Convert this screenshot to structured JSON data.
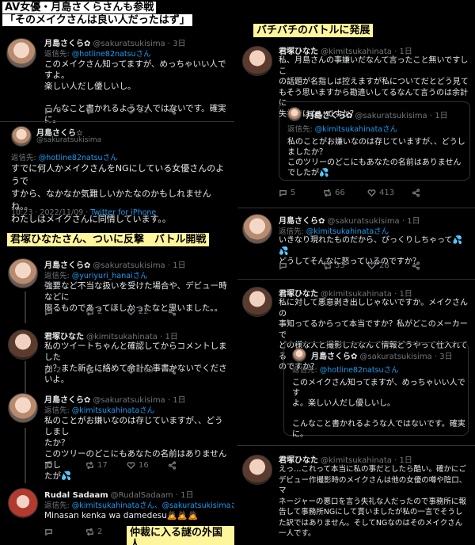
{
  "captions": {
    "top_left_1": "AV女優・月島さくらさんも参戦",
    "top_left_2": "「そのメイクさんは良い人だったはず」",
    "top_right": "バチバチのバトルに発展",
    "mid_left": "君塚ひなたさん、ついに反撃　バトル開戦",
    "bottom": "仲裁に入る謎の外国人"
  },
  "left": {
    "t1": {
      "name": "月島さくら✿",
      "handle": "@sakuratsukisima · 3日",
      "reply_prefix": "返信先: ",
      "reply_to": "@hotline82natsuさん",
      "body": "このメイクさん知ってますが、めっちゃいい人ですよ。\n楽しい人だし優しいし。\n\nこんなこと書かれるような人ではないです。確実に。",
      "replies": "8",
      "retweets": "",
      "likes": "21"
    },
    "t2": {
      "name": "月島さくら☆",
      "handle": "@sakuratsukisima",
      "reply_prefix": "返信先: ",
      "reply_to": "@hotline82natsuさん",
      "body": "すでに何人かメイクさんをNGにしている女優さんのようで\nすから、なかなか気難しいかたなのかもしれませんね。。\nわたしはメイクさんに同情しています。。",
      "date": "10:23 · 2022/11/09 · ",
      "client": "Twitter for iPhone"
    },
    "t3": {
      "name": "月島さくら✿",
      "handle": "@sakuratsukisima · 1日",
      "reply_prefix": "返信先: ",
      "reply_to": "@yuriyuri_hanaiさん",
      "body": "強要など不当な扱いを受けた場合や、デビュー時などに\n限るものであってほしかったなと思いました。。",
      "replies": "",
      "retweets": "2",
      "likes": "22"
    },
    "t4": {
      "name": "君塚ひなた",
      "handle": "@kimitsukahinata · 1日",
      "body": "私のツイートちゃんと確認してからコメントしました\nか？また新たに絡めて余計な事書かないでくださいよ。",
      "replies": "2",
      "retweets": "1",
      "likes": "109"
    },
    "t5": {
      "name": "月島さくら✿",
      "handle": "@sakuratsukisima · 1日",
      "reply_prefix": "返信先: ",
      "reply_to": "@kimitsukahinataさん",
      "body": "私のことがお嫌いなのは存じていますが、、どうしまし\nたか？\nこのツリーのどこにもあなたの名前はありませんでし\nたが💦",
      "replies": "",
      "retweets": "17",
      "likes": "16"
    },
    "t6": {
      "name": "Rudal Sadaam",
      "handle": "@RudalSadaam · 1日",
      "reply_prefix": "返信先: ",
      "reply_to": "@kimitsukahinataさん、@sakuratsukisimaさん",
      "body": "Minasan kenka wa damedesu🙇🙇🙇",
      "replies": "",
      "retweets": "2",
      "likes": ""
    }
  },
  "right": {
    "r1": {
      "name": "君塚ひなた",
      "handle": "@kimitsukahinata · 1日",
      "body": "私、月島さんの事嫌いだなんて言ったこと無いですしこ\nの話題が名指しは控えますが私についてだとどう見て\nもそう思いますから勘違いしてるなんて言うのは余計に\n失礼ではないですか？",
      "replies": "5",
      "retweets": "66",
      "likes": "413"
    },
    "q1": {
      "name": "月島さくら✿",
      "handle": "@sakuratsukisima · 1日",
      "reply_prefix": "返信先: ",
      "reply_to": "@kimitsukahinataさん",
      "body": "私のことがお嫌いなのは存じていますが、、どうし\nましたか？\nこのツリーのどこにもあなたの名前はありません\nでしたが💦"
    },
    "r2": {
      "name": "月島さくら✿",
      "handle": "@sakuratsukisima · 1日",
      "reply_prefix": "返信先: ",
      "reply_to": "@kimitsukahinataさん",
      "body": "いきなり現れたものだから、びっくりしちゃって💦💦\nどうしてそんなに怒っているのですか？",
      "replies": "",
      "retweets": "33",
      "likes": "28"
    },
    "r3": {
      "name": "君塚ひなた",
      "handle": "@kimitsukahinata · 1日",
      "body": "私に対して悪意剥き出しじゃないですか。メイクさんの\n事知ってるからって本当ですか？私がどこのメーカーで\nどの様な人と撮影したなんて情報どうやって仕入れてる\nのですか？"
    },
    "q2": {
      "name": "月島さくら✿",
      "handle": "@sakuratsukisima · 3日",
      "reply_prefix": "返信先: ",
      "reply_to": "@hotline82natsuさん",
      "body": "このメイクさん知ってますが、めっちゃいい人です\nよ。楽しい人だし優しいし。\n\nこんなこと書かれるような人ではないです。確実\nに。"
    },
    "r4": {
      "name": "君塚ひなた",
      "handle": "@kimitsukahinata · 1日",
      "body": "えっ…これって本当に私の事だとしたら酷い。確かにご\nデビュー作撮影時のメイクさんは他の女優の噂や陰口、マ\nネージャーの悪口を言う失礼な人だったので事務所に報\n告して事務所NGにして貰いましたが私の一言でそうし\nた訳ではありません。そしてNGなのはそのメイクさん\n一人です。"
    }
  },
  "colors": {
    "accent": "#1d9bf0",
    "bg": "#000000",
    "text": "#e7e9ea",
    "muted": "#71767b"
  }
}
